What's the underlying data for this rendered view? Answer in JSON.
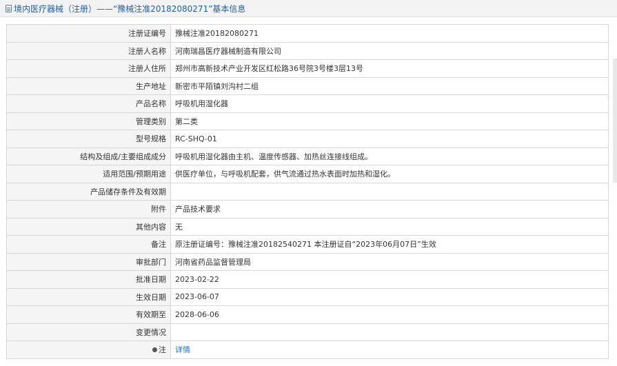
{
  "header": {
    "title": "境内医疗器械（注册）——“豫械注准20182080271”基本信息"
  },
  "rows": [
    {
      "label": "注册证编号",
      "value": "豫械注准20182080271"
    },
    {
      "label": "注册人名称",
      "value": "河南瑞昌医疗器械制造有限公司"
    },
    {
      "label": "注册人住所",
      "value": "郑州市高新技术产业开发区红松路36号院3号楼3层13号"
    },
    {
      "label": "生产地址",
      "value": "新密市平陌镇刘沟村二组"
    },
    {
      "label": "产品名称",
      "value": "呼吸机用湿化器"
    },
    {
      "label": "管理类别",
      "value": "第二类"
    },
    {
      "label": "型号规格",
      "value": "RC-SHQ-01"
    },
    {
      "label": "结构及组成/主要组成成分",
      "value": "呼吸机用湿化器由主机、温度传感器、加热丝连接线组成。"
    },
    {
      "label": "适用范围/预期用途",
      "value": "供医疗单位，与呼吸机配套，供气流通过热水表面时加热和湿化。"
    },
    {
      "label": "产品储存条件及有效期",
      "value": ""
    },
    {
      "label": "附件",
      "value": "产品技术要求"
    },
    {
      "label": "其他内容",
      "value": "无"
    },
    {
      "label": "备注",
      "value": "原注册证编号：豫械注准20182540271 本注册证自“2023年06月07日”生效"
    },
    {
      "label": "审批部门",
      "value": "河南省药品监督管理局"
    },
    {
      "label": "批准日期",
      "value": "2023-02-22"
    },
    {
      "label": "生效日期",
      "value": "2023-06-07"
    },
    {
      "label": "有效期至",
      "value": "2028-06-06"
    },
    {
      "label": "变更情况",
      "value": ""
    }
  ],
  "note_row": {
    "label": "注",
    "link": "详情"
  },
  "icons": {
    "title_icon": "document-icon",
    "note_icon": "pin-icon"
  }
}
